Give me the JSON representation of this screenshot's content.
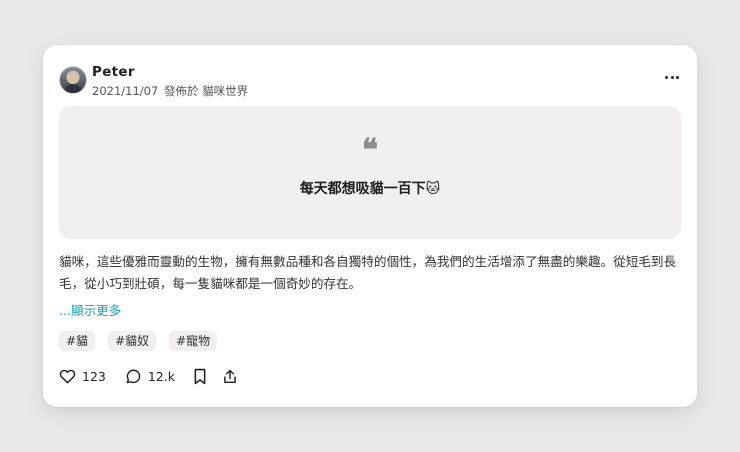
{
  "post": {
    "author": "Peter",
    "date": "2021/11/07",
    "posted_in_label": "發佈於",
    "community": "貓咪世界",
    "more_icon": "more-horizontal-icon"
  },
  "quote": {
    "mark": "❝",
    "text": "每天都想吸貓一百下🐱"
  },
  "body": {
    "text": "貓咪，這些優雅而靈動的生物，擁有無數品種和各自獨特的個性，為我們的生活增添了無盡的樂趣。從短毛到長毛，從小巧到壯碩，每一隻貓咪都是一個奇妙的存在。",
    "show_more": "...顯示更多"
  },
  "tags": [
    "#貓",
    "#貓奴",
    "#寵物"
  ],
  "actions": {
    "likes": "123",
    "comments": "12.k"
  },
  "colors": {
    "accent": "#1aa3b8",
    "quote_bg": "#f1f0ee"
  }
}
